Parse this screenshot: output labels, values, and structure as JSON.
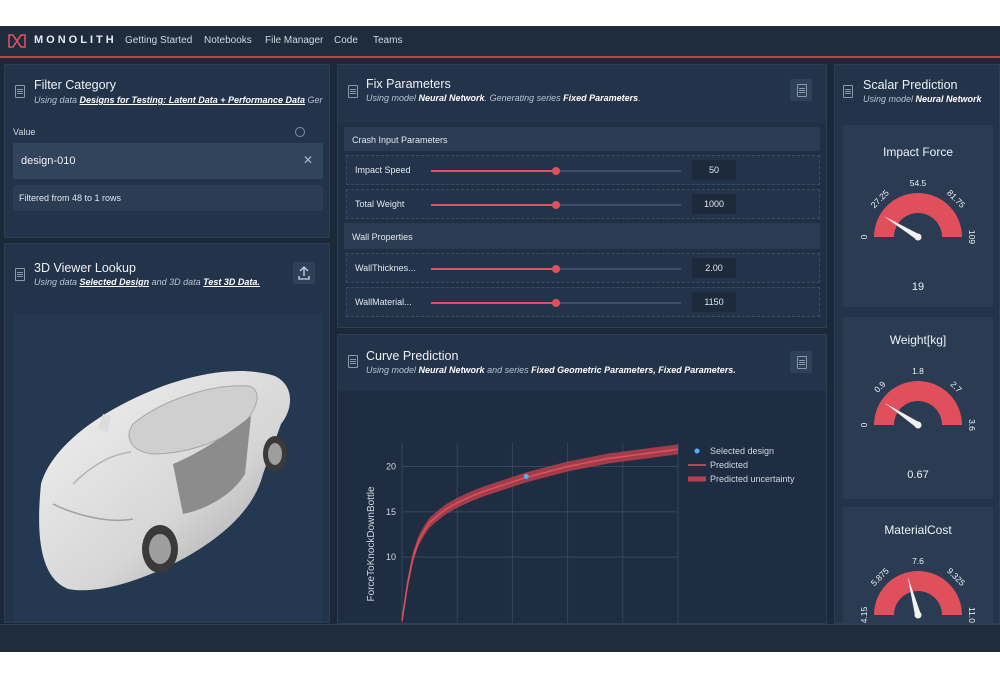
{
  "app": {
    "brand": "MONOLITH",
    "nav": [
      "Getting Started",
      "Notebooks",
      "File Manager",
      "Code",
      "Teams"
    ]
  },
  "filter": {
    "title": "Filter Category",
    "sub_prefix": "Using data",
    "sub_data": "Designs for Testing: Latent Data + Performance Data",
    "sub_suffix": "Ger",
    "value_label": "Value",
    "value": "design-010",
    "status": "Filtered from 48 to 1 rows"
  },
  "viewer": {
    "title": "3D Viewer Lookup",
    "sub_prefix": "Using data",
    "sub_data": "Selected Design",
    "sub_mid": "and 3D data",
    "sub_data2": "Test 3D Data."
  },
  "fix": {
    "title": "Fix Parameters",
    "sub_prefix": "Using model",
    "sub_model": "Neural Network",
    "sub_mid": ". Generating series",
    "sub_series": "Fixed Parameters",
    "sub_end": ".",
    "section1": "Crash Input Parameters",
    "section2": "Wall Properties",
    "sliders": [
      {
        "label": "Impact Speed",
        "value": "50",
        "fraction": 0.5
      },
      {
        "label": "Total Weight",
        "value": "1000",
        "fraction": 0.5
      },
      {
        "label": "WallThicknes...",
        "value": "2.00",
        "fraction": 0.5
      },
      {
        "label": "WallMaterial...",
        "value": "1150",
        "fraction": 0.5
      }
    ]
  },
  "curve": {
    "title": "Curve Prediction",
    "sub_prefix": "Using model",
    "sub_model": "Neural Network",
    "sub_mid": "and series",
    "sub_series1": "Fixed Geometric Parameters,",
    "sub_series2": "Fixed Parameters."
  },
  "chart_data": {
    "type": "line",
    "ylabel": "ForceToKnockDownBottle",
    "xlabel": "",
    "yticks": [
      10,
      15,
      20
    ],
    "ylim": [
      2.5,
      22.6
    ],
    "xlim": [
      0,
      100
    ],
    "grid": true,
    "legend_position": "top-right",
    "series": [
      {
        "name": "Selected design",
        "kind": "scatter",
        "x": [
          45
        ],
        "y": [
          18.9
        ],
        "color": "#4fb3ff"
      },
      {
        "name": "Predicted",
        "kind": "line",
        "color": "#e0505c",
        "x": [
          0,
          2,
          4,
          6,
          8,
          10,
          13,
          16,
          20,
          25,
          30,
          35,
          40,
          45,
          50,
          55,
          60,
          65,
          70,
          75,
          80,
          85,
          90,
          95,
          100
        ],
        "y": [
          3,
          7,
          10,
          11.8,
          12.9,
          13.8,
          14.6,
          15.3,
          16,
          16.7,
          17.3,
          17.8,
          18.3,
          18.8,
          19.2,
          19.6,
          20,
          20.3,
          20.6,
          20.9,
          21.1,
          21.3,
          21.5,
          21.7,
          21.9
        ]
      },
      {
        "name": "Predicted uncertainty",
        "kind": "band",
        "color": "#b8404c",
        "band": 0.55
      }
    ]
  },
  "scalar": {
    "title": "Scalar Prediction",
    "sub_prefix": "Using model",
    "sub_model": "Neural Network",
    "gauges": [
      {
        "title": "Impact Force",
        "ticks": [
          "0",
          "27.25",
          "54.5",
          "81.75",
          "109"
        ],
        "min": 0,
        "max": 109,
        "value": 19,
        "value_label": "19"
      },
      {
        "title": "Weight[kg]",
        "ticks": [
          "0",
          "0.9",
          "1.8",
          "2.7",
          "3.6"
        ],
        "min": 0,
        "max": 3.6,
        "value": 0.67,
        "value_label": "0.67"
      },
      {
        "title": "MaterialCost",
        "ticks": [
          "4.15",
          "5.875",
          "7.6",
          "9.325",
          "11.0"
        ],
        "min": 4.15,
        "max": 11.0,
        "value": 7.0,
        "value_label": ""
      }
    ]
  },
  "colors": {
    "accent": "#e0505c",
    "panel": "#23334a",
    "background": "#1b2838",
    "point": "#4fb3ff"
  },
  "icons": [
    "monolith-logo-icon",
    "document-icon",
    "info-icon",
    "clear-icon",
    "upload-icon"
  ]
}
